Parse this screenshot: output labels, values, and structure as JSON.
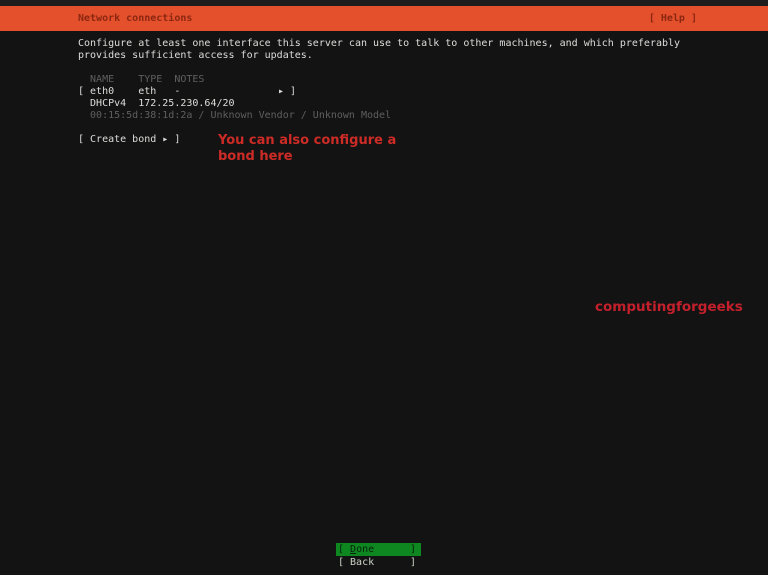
{
  "header": {
    "title": "Network connections",
    "help_label": "[ Help ]"
  },
  "intro": {
    "line1": "Configure at least one interface this server can use to talk to other machines, and which preferably",
    "line2": "provides sufficient access for updates."
  },
  "device_table": {
    "header_line": "  NAME    TYPE  NOTES",
    "row": {
      "name": "eth0",
      "type": "eth",
      "notes": "-",
      "left_text": "[ eth0    eth   -",
      "arrow": "▸ ]"
    },
    "dhcp_line": "  DHCPv4  172.25.230.64/20",
    "info_line": "  00:15:5d:38:1d:2a / Unknown Vendor / Unknown Model"
  },
  "create_bond": {
    "label": "[ Create bond ▸ ]"
  },
  "annotations": {
    "bond_note_line1": "You can also configure a",
    "bond_note_line2": "bond here",
    "watermark": "computingforgeeks"
  },
  "footer": {
    "done": {
      "open": "[ ",
      "accel": "D",
      "rest": "one",
      "close": "]"
    },
    "back": {
      "open": "[ Back",
      "close": "]"
    }
  },
  "colors": {
    "header_bg": "#e4502c",
    "header_text": "#8b2611",
    "body_text": "#dedddb",
    "dim_text": "#5f5f5f",
    "annotation_red": "#cd2b26",
    "watermark_red": "#c4202c",
    "done_bg": "#0f8721",
    "back_text": "#cbd4c6"
  }
}
